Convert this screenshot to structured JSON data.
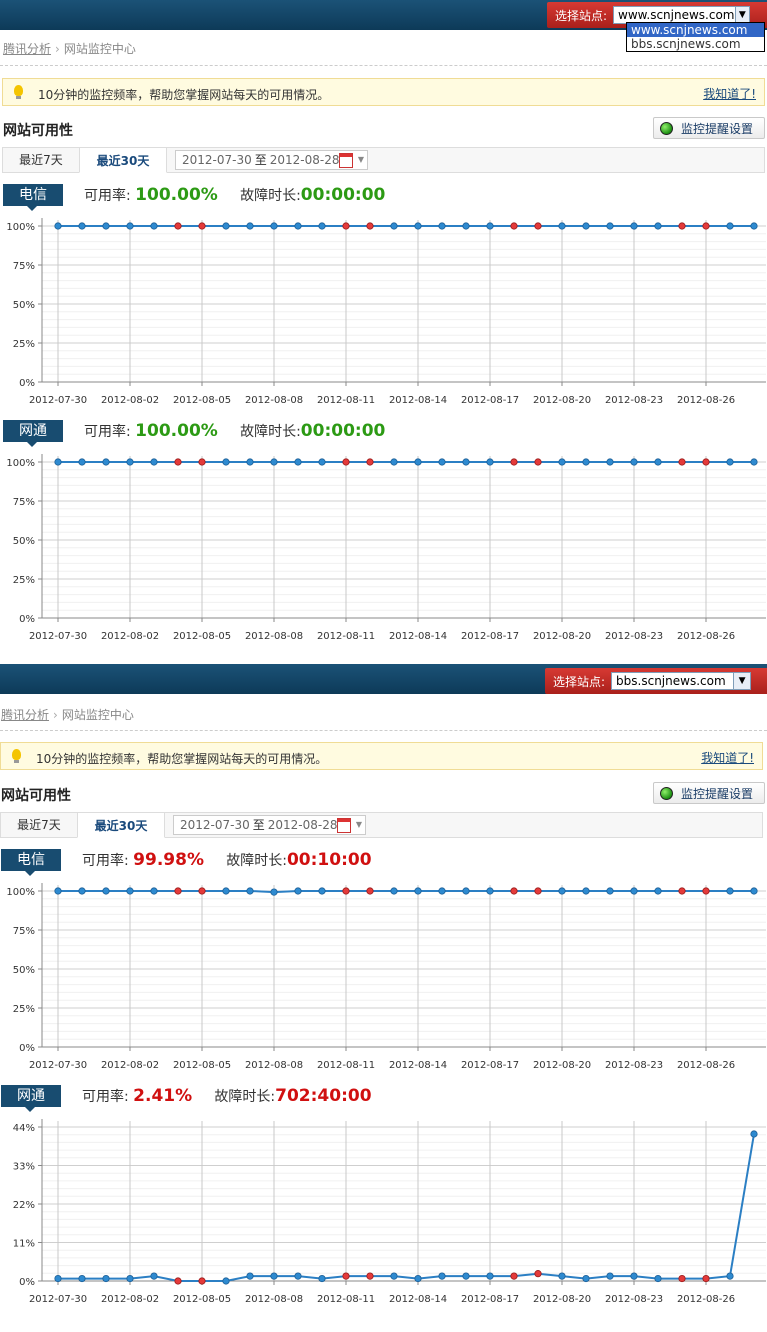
{
  "screens": [
    {
      "site_label": "选择站点:",
      "site_value": "www.scnjnews.com",
      "dropdown_open": true,
      "dropdown_options": [
        "www.scnjnews.com",
        "bbs.scnjnews.com"
      ],
      "breadcrumb": {
        "root": "腾讯分析",
        "current": "网站监控中心"
      },
      "tip": {
        "text": "10分钟的监控频率，帮助您掌握网站每天的可用情况。",
        "ok_link": "我知道了!"
      },
      "section_title": "网站可用性",
      "alert_button": "监控提醒设置",
      "tabs": [
        "最近7天",
        "最近30天"
      ],
      "active_tab": "最近30天",
      "date_range": {
        "start": "2012-07-30",
        "to": "至",
        "end": "2012-08-28"
      },
      "isps": [
        {
          "name": "电信",
          "availability_label": "可用率:",
          "availability": "100.00%",
          "downtime_label": "故障时长:",
          "downtime": "00:00:00",
          "status_color": "#2c9a14"
        },
        {
          "name": "网通",
          "availability_label": "可用率:",
          "availability": "100.00%",
          "downtime_label": "故障时长:",
          "downtime": "00:00:00",
          "status_color": "#2c9a14"
        }
      ]
    },
    {
      "site_label": "选择站点:",
      "site_value": "bbs.scnjnews.com",
      "dropdown_open": false,
      "dropdown_options": [],
      "breadcrumb": {
        "root": "腾讯分析",
        "current": "网站监控中心"
      },
      "tip": {
        "text": "10分钟的监控频率，帮助您掌握网站每天的可用情况。",
        "ok_link": "我知道了!"
      },
      "section_title": "网站可用性",
      "alert_button": "监控提醒设置",
      "tabs": [
        "最近7天",
        "最近30天"
      ],
      "active_tab": "最近30天",
      "date_range": {
        "start": "2012-07-30",
        "to": "至",
        "end": "2012-08-28"
      },
      "isps": [
        {
          "name": "电信",
          "availability_label": "可用率:",
          "availability": "99.98%",
          "downtime_label": "故障时长:",
          "downtime": "00:10:00",
          "status_color": "#d01010"
        },
        {
          "name": "网通",
          "availability_label": "可用率:",
          "availability": "2.41%",
          "downtime_label": "故障时长:",
          "downtime": "702:40:00",
          "status_color": "#d01010"
        }
      ]
    }
  ],
  "colors": {
    "line": "#2b7fc4",
    "point_normal": "#2e8ad0",
    "point_weekend": "#e43a3a",
    "header": "#184c70"
  },
  "chart_data": [
    {
      "type": "line",
      "title": "电信",
      "x": [
        "2012-07-30",
        "2012-07-31",
        "2012-08-01",
        "2012-08-02",
        "2012-08-03",
        "2012-08-04",
        "2012-08-05",
        "2012-08-06",
        "2012-08-07",
        "2012-08-08",
        "2012-08-09",
        "2012-08-10",
        "2012-08-11",
        "2012-08-12",
        "2012-08-13",
        "2012-08-14",
        "2012-08-15",
        "2012-08-16",
        "2012-08-17",
        "2012-08-18",
        "2012-08-19",
        "2012-08-20",
        "2012-08-21",
        "2012-08-22",
        "2012-08-23",
        "2012-08-24",
        "2012-08-25",
        "2012-08-26",
        "2012-08-27",
        "2012-08-28"
      ],
      "xticks": [
        "2012-07-30",
        "2012-08-02",
        "2012-08-05",
        "2012-08-08",
        "2012-08-11",
        "2012-08-14",
        "2012-08-17",
        "2012-08-20",
        "2012-08-23",
        "2012-08-26"
      ],
      "values": [
        100,
        100,
        100,
        100,
        100,
        100,
        100,
        100,
        100,
        100,
        100,
        100,
        100,
        100,
        100,
        100,
        100,
        100,
        100,
        100,
        100,
        100,
        100,
        100,
        100,
        100,
        100,
        100,
        100,
        100
      ],
      "highlight": [
        5,
        6,
        12,
        13,
        19,
        20,
        26,
        27
      ],
      "yticks": [
        "0%",
        "25%",
        "50%",
        "75%",
        "100%"
      ],
      "ylim": [
        0,
        100
      ],
      "grid": true
    },
    {
      "type": "line",
      "title": "网通",
      "x": [
        "2012-07-30",
        "2012-07-31",
        "2012-08-01",
        "2012-08-02",
        "2012-08-03",
        "2012-08-04",
        "2012-08-05",
        "2012-08-06",
        "2012-08-07",
        "2012-08-08",
        "2012-08-09",
        "2012-08-10",
        "2012-08-11",
        "2012-08-12",
        "2012-08-13",
        "2012-08-14",
        "2012-08-15",
        "2012-08-16",
        "2012-08-17",
        "2012-08-18",
        "2012-08-19",
        "2012-08-20",
        "2012-08-21",
        "2012-08-22",
        "2012-08-23",
        "2012-08-24",
        "2012-08-25",
        "2012-08-26",
        "2012-08-27",
        "2012-08-28"
      ],
      "xticks": [
        "2012-07-30",
        "2012-08-02",
        "2012-08-05",
        "2012-08-08",
        "2012-08-11",
        "2012-08-14",
        "2012-08-17",
        "2012-08-20",
        "2012-08-23",
        "2012-08-26"
      ],
      "values": [
        100,
        100,
        100,
        100,
        100,
        100,
        100,
        100,
        100,
        100,
        100,
        100,
        100,
        100,
        100,
        100,
        100,
        100,
        100,
        100,
        100,
        100,
        100,
        100,
        100,
        100,
        100,
        100,
        100,
        100
      ],
      "highlight": [
        5,
        6,
        12,
        13,
        19,
        20,
        26,
        27
      ],
      "yticks": [
        "0%",
        "25%",
        "50%",
        "75%",
        "100%"
      ],
      "ylim": [
        0,
        100
      ],
      "grid": true
    },
    {
      "type": "line",
      "title": "电信",
      "x": [
        "2012-07-30",
        "2012-07-31",
        "2012-08-01",
        "2012-08-02",
        "2012-08-03",
        "2012-08-04",
        "2012-08-05",
        "2012-08-06",
        "2012-08-07",
        "2012-08-08",
        "2012-08-09",
        "2012-08-10",
        "2012-08-11",
        "2012-08-12",
        "2012-08-13",
        "2012-08-14",
        "2012-08-15",
        "2012-08-16",
        "2012-08-17",
        "2012-08-18",
        "2012-08-19",
        "2012-08-20",
        "2012-08-21",
        "2012-08-22",
        "2012-08-23",
        "2012-08-24",
        "2012-08-25",
        "2012-08-26",
        "2012-08-27",
        "2012-08-28"
      ],
      "xticks": [
        "2012-07-30",
        "2012-08-02",
        "2012-08-05",
        "2012-08-08",
        "2012-08-11",
        "2012-08-14",
        "2012-08-17",
        "2012-08-20",
        "2012-08-23",
        "2012-08-26"
      ],
      "values": [
        100,
        100,
        100,
        100,
        100,
        100,
        100,
        100,
        100,
        99.3,
        100,
        100,
        100,
        100,
        100,
        100,
        100,
        100,
        100,
        100,
        100,
        100,
        100,
        100,
        100,
        100,
        100,
        100,
        100,
        100
      ],
      "highlight": [
        5,
        6,
        12,
        13,
        19,
        20,
        26,
        27
      ],
      "yticks": [
        "0%",
        "25%",
        "50%",
        "75%",
        "100%"
      ],
      "ylim": [
        0,
        100
      ],
      "grid": true
    },
    {
      "type": "line",
      "title": "网通",
      "x": [
        "2012-07-30",
        "2012-07-31",
        "2012-08-01",
        "2012-08-02",
        "2012-08-03",
        "2012-08-04",
        "2012-08-05",
        "2012-08-06",
        "2012-08-07",
        "2012-08-08",
        "2012-08-09",
        "2012-08-10",
        "2012-08-11",
        "2012-08-12",
        "2012-08-13",
        "2012-08-14",
        "2012-08-15",
        "2012-08-16",
        "2012-08-17",
        "2012-08-18",
        "2012-08-19",
        "2012-08-20",
        "2012-08-21",
        "2012-08-22",
        "2012-08-23",
        "2012-08-24",
        "2012-08-25",
        "2012-08-26",
        "2012-08-27",
        "2012-08-28"
      ],
      "xticks": [
        "2012-07-30",
        "2012-08-02",
        "2012-08-05",
        "2012-08-08",
        "2012-08-11",
        "2012-08-14",
        "2012-08-17",
        "2012-08-20",
        "2012-08-23",
        "2012-08-26"
      ],
      "values": [
        0.7,
        0.7,
        0.7,
        0.7,
        1.4,
        0,
        0,
        0,
        1.4,
        1.4,
        1.4,
        0.7,
        1.4,
        1.4,
        1.4,
        0.7,
        1.4,
        1.4,
        1.4,
        1.4,
        2.1,
        1.4,
        0.7,
        1.4,
        1.4,
        0.7,
        0.7,
        0.7,
        1.4,
        42
      ],
      "highlight": [
        5,
        6,
        12,
        13,
        19,
        20,
        26,
        27
      ],
      "yticks": [
        "0%",
        "11%",
        "22%",
        "33%",
        "44%"
      ],
      "ylim": [
        0,
        44
      ],
      "grid": true
    }
  ]
}
